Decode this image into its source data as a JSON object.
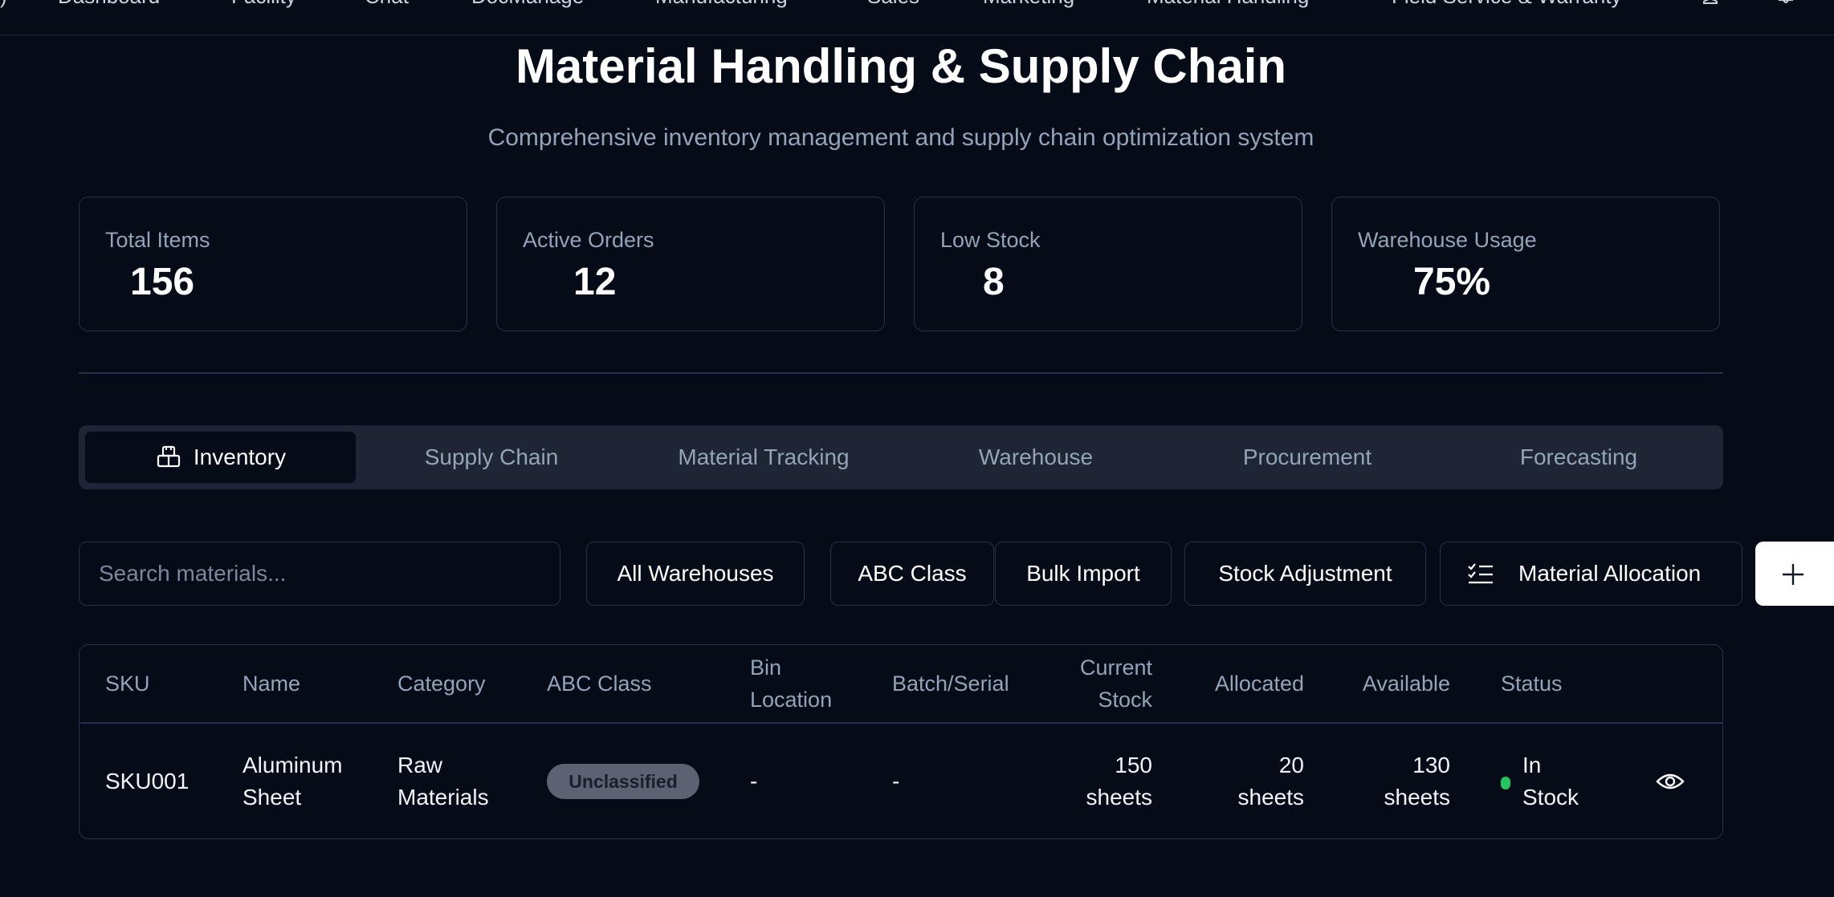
{
  "nav": {
    "items": [
      "Dashboard",
      "Facility",
      "Chat",
      "DocManage",
      "Manufacturing",
      "Sales",
      "Marketing",
      "Material Handling",
      "Field Service & Warranty"
    ],
    "icons": [
      "user-icon",
      "bell-icon"
    ]
  },
  "header": {
    "title": "Material Handling & Supply Chain",
    "subtitle": "Comprehensive inventory management and supply chain optimization system"
  },
  "stats": [
    {
      "label": "Total Items",
      "value": "156"
    },
    {
      "label": "Active Orders",
      "value": "12"
    },
    {
      "label": "Low Stock",
      "value": "8"
    },
    {
      "label": "Warehouse Usage",
      "value": "75%"
    }
  ],
  "tabs": [
    {
      "label": "Inventory",
      "icon": "boxes-icon",
      "active": true
    },
    {
      "label": "Supply Chain"
    },
    {
      "label": "Material Tracking"
    },
    {
      "label": "Warehouse"
    },
    {
      "label": "Procurement"
    },
    {
      "label": "Forecasting"
    }
  ],
  "toolbar": {
    "search_placeholder": "Search materials...",
    "warehouse_filter": "All Warehouses",
    "abc_filter": "ABC Class",
    "bulk_import": "Bulk Import",
    "stock_adjustment": "Stock Adjustment",
    "material_allocation": "Material Allocation",
    "add_icon": "plus-icon"
  },
  "table": {
    "headers": {
      "sku": "SKU",
      "name": "Name",
      "category": "Category",
      "abc_class": "ABC Class",
      "bin_location": [
        "Bin",
        "Location"
      ],
      "batch_serial": "Batch/Serial",
      "current_stock": [
        "Current",
        "Stock"
      ],
      "allocated": "Allocated",
      "available": "Available",
      "status": "Status"
    },
    "rows": [
      {
        "sku": "SKU001",
        "name": [
          "Aluminum",
          "Sheet"
        ],
        "category": [
          "Raw",
          "Materials"
        ],
        "abc_class": "Unclassified",
        "bin_location": "-",
        "batch_serial": "-",
        "current_stock": [
          "150",
          "sheets"
        ],
        "allocated": [
          "20",
          "sheets"
        ],
        "available": [
          "130",
          "sheets"
        ],
        "status": [
          "In",
          "Stock"
        ],
        "status_color": "#22c55e",
        "action_icon": "eye-icon"
      }
    ]
  }
}
